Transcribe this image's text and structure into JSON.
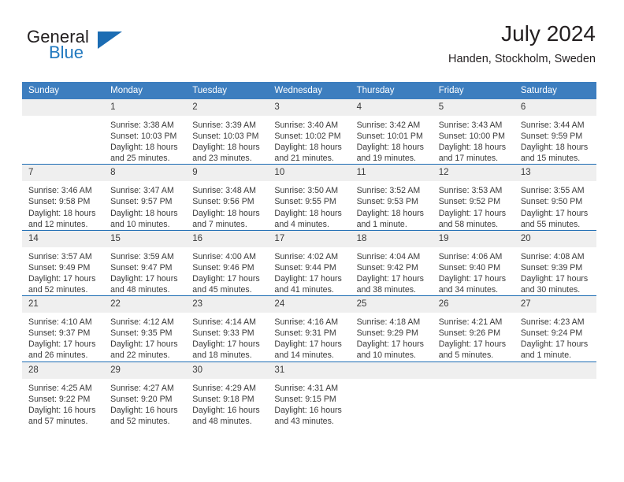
{
  "brand": {
    "name_part1": "General",
    "name_part2": "Blue",
    "logo_icon": "blue-triangle-icon",
    "accent_color": "#1b6cb3"
  },
  "header": {
    "title": "July 2024",
    "subtitle": "Handen, Stockholm, Sweden"
  },
  "colors": {
    "header_bar": "#3d7ebf",
    "row_divider": "#1b6cb3",
    "date_band": "#efefef",
    "text": "#3a3a3a"
  },
  "weekday_headers": [
    "Sunday",
    "Monday",
    "Tuesday",
    "Wednesday",
    "Thursday",
    "Friday",
    "Saturday"
  ],
  "weeks": [
    [
      {
        "day": "",
        "empty": true
      },
      {
        "day": "1",
        "sunrise": "Sunrise: 3:38 AM",
        "sunset": "Sunset: 10:03 PM",
        "daylight_line1": "Daylight: 18 hours",
        "daylight_line2": "and 25 minutes."
      },
      {
        "day": "2",
        "sunrise": "Sunrise: 3:39 AM",
        "sunset": "Sunset: 10:03 PM",
        "daylight_line1": "Daylight: 18 hours",
        "daylight_line2": "and 23 minutes."
      },
      {
        "day": "3",
        "sunrise": "Sunrise: 3:40 AM",
        "sunset": "Sunset: 10:02 PM",
        "daylight_line1": "Daylight: 18 hours",
        "daylight_line2": "and 21 minutes."
      },
      {
        "day": "4",
        "sunrise": "Sunrise: 3:42 AM",
        "sunset": "Sunset: 10:01 PM",
        "daylight_line1": "Daylight: 18 hours",
        "daylight_line2": "and 19 minutes."
      },
      {
        "day": "5",
        "sunrise": "Sunrise: 3:43 AM",
        "sunset": "Sunset: 10:00 PM",
        "daylight_line1": "Daylight: 18 hours",
        "daylight_line2": "and 17 minutes."
      },
      {
        "day": "6",
        "sunrise": "Sunrise: 3:44 AM",
        "sunset": "Sunset: 9:59 PM",
        "daylight_line1": "Daylight: 18 hours",
        "daylight_line2": "and 15 minutes."
      }
    ],
    [
      {
        "day": "7",
        "sunrise": "Sunrise: 3:46 AM",
        "sunset": "Sunset: 9:58 PM",
        "daylight_line1": "Daylight: 18 hours",
        "daylight_line2": "and 12 minutes."
      },
      {
        "day": "8",
        "sunrise": "Sunrise: 3:47 AM",
        "sunset": "Sunset: 9:57 PM",
        "daylight_line1": "Daylight: 18 hours",
        "daylight_line2": "and 10 minutes."
      },
      {
        "day": "9",
        "sunrise": "Sunrise: 3:48 AM",
        "sunset": "Sunset: 9:56 PM",
        "daylight_line1": "Daylight: 18 hours",
        "daylight_line2": "and 7 minutes."
      },
      {
        "day": "10",
        "sunrise": "Sunrise: 3:50 AM",
        "sunset": "Sunset: 9:55 PM",
        "daylight_line1": "Daylight: 18 hours",
        "daylight_line2": "and 4 minutes."
      },
      {
        "day": "11",
        "sunrise": "Sunrise: 3:52 AM",
        "sunset": "Sunset: 9:53 PM",
        "daylight_line1": "Daylight: 18 hours",
        "daylight_line2": "and 1 minute."
      },
      {
        "day": "12",
        "sunrise": "Sunrise: 3:53 AM",
        "sunset": "Sunset: 9:52 PM",
        "daylight_line1": "Daylight: 17 hours",
        "daylight_line2": "and 58 minutes."
      },
      {
        "day": "13",
        "sunrise": "Sunrise: 3:55 AM",
        "sunset": "Sunset: 9:50 PM",
        "daylight_line1": "Daylight: 17 hours",
        "daylight_line2": "and 55 minutes."
      }
    ],
    [
      {
        "day": "14",
        "sunrise": "Sunrise: 3:57 AM",
        "sunset": "Sunset: 9:49 PM",
        "daylight_line1": "Daylight: 17 hours",
        "daylight_line2": "and 52 minutes."
      },
      {
        "day": "15",
        "sunrise": "Sunrise: 3:59 AM",
        "sunset": "Sunset: 9:47 PM",
        "daylight_line1": "Daylight: 17 hours",
        "daylight_line2": "and 48 minutes."
      },
      {
        "day": "16",
        "sunrise": "Sunrise: 4:00 AM",
        "sunset": "Sunset: 9:46 PM",
        "daylight_line1": "Daylight: 17 hours",
        "daylight_line2": "and 45 minutes."
      },
      {
        "day": "17",
        "sunrise": "Sunrise: 4:02 AM",
        "sunset": "Sunset: 9:44 PM",
        "daylight_line1": "Daylight: 17 hours",
        "daylight_line2": "and 41 minutes."
      },
      {
        "day": "18",
        "sunrise": "Sunrise: 4:04 AM",
        "sunset": "Sunset: 9:42 PM",
        "daylight_line1": "Daylight: 17 hours",
        "daylight_line2": "and 38 minutes."
      },
      {
        "day": "19",
        "sunrise": "Sunrise: 4:06 AM",
        "sunset": "Sunset: 9:40 PM",
        "daylight_line1": "Daylight: 17 hours",
        "daylight_line2": "and 34 minutes."
      },
      {
        "day": "20",
        "sunrise": "Sunrise: 4:08 AM",
        "sunset": "Sunset: 9:39 PM",
        "daylight_line1": "Daylight: 17 hours",
        "daylight_line2": "and 30 minutes."
      }
    ],
    [
      {
        "day": "21",
        "sunrise": "Sunrise: 4:10 AM",
        "sunset": "Sunset: 9:37 PM",
        "daylight_line1": "Daylight: 17 hours",
        "daylight_line2": "and 26 minutes."
      },
      {
        "day": "22",
        "sunrise": "Sunrise: 4:12 AM",
        "sunset": "Sunset: 9:35 PM",
        "daylight_line1": "Daylight: 17 hours",
        "daylight_line2": "and 22 minutes."
      },
      {
        "day": "23",
        "sunrise": "Sunrise: 4:14 AM",
        "sunset": "Sunset: 9:33 PM",
        "daylight_line1": "Daylight: 17 hours",
        "daylight_line2": "and 18 minutes."
      },
      {
        "day": "24",
        "sunrise": "Sunrise: 4:16 AM",
        "sunset": "Sunset: 9:31 PM",
        "daylight_line1": "Daylight: 17 hours",
        "daylight_line2": "and 14 minutes."
      },
      {
        "day": "25",
        "sunrise": "Sunrise: 4:18 AM",
        "sunset": "Sunset: 9:29 PM",
        "daylight_line1": "Daylight: 17 hours",
        "daylight_line2": "and 10 minutes."
      },
      {
        "day": "26",
        "sunrise": "Sunrise: 4:21 AM",
        "sunset": "Sunset: 9:26 PM",
        "daylight_line1": "Daylight: 17 hours",
        "daylight_line2": "and 5 minutes."
      },
      {
        "day": "27",
        "sunrise": "Sunrise: 4:23 AM",
        "sunset": "Sunset: 9:24 PM",
        "daylight_line1": "Daylight: 17 hours",
        "daylight_line2": "and 1 minute."
      }
    ],
    [
      {
        "day": "28",
        "sunrise": "Sunrise: 4:25 AM",
        "sunset": "Sunset: 9:22 PM",
        "daylight_line1": "Daylight: 16 hours",
        "daylight_line2": "and 57 minutes."
      },
      {
        "day": "29",
        "sunrise": "Sunrise: 4:27 AM",
        "sunset": "Sunset: 9:20 PM",
        "daylight_line1": "Daylight: 16 hours",
        "daylight_line2": "and 52 minutes."
      },
      {
        "day": "30",
        "sunrise": "Sunrise: 4:29 AM",
        "sunset": "Sunset: 9:18 PM",
        "daylight_line1": "Daylight: 16 hours",
        "daylight_line2": "and 48 minutes."
      },
      {
        "day": "31",
        "sunrise": "Sunrise: 4:31 AM",
        "sunset": "Sunset: 9:15 PM",
        "daylight_line1": "Daylight: 16 hours",
        "daylight_line2": "and 43 minutes."
      },
      {
        "day": "",
        "empty": true
      },
      {
        "day": "",
        "empty": true
      },
      {
        "day": "",
        "empty": true
      }
    ]
  ]
}
